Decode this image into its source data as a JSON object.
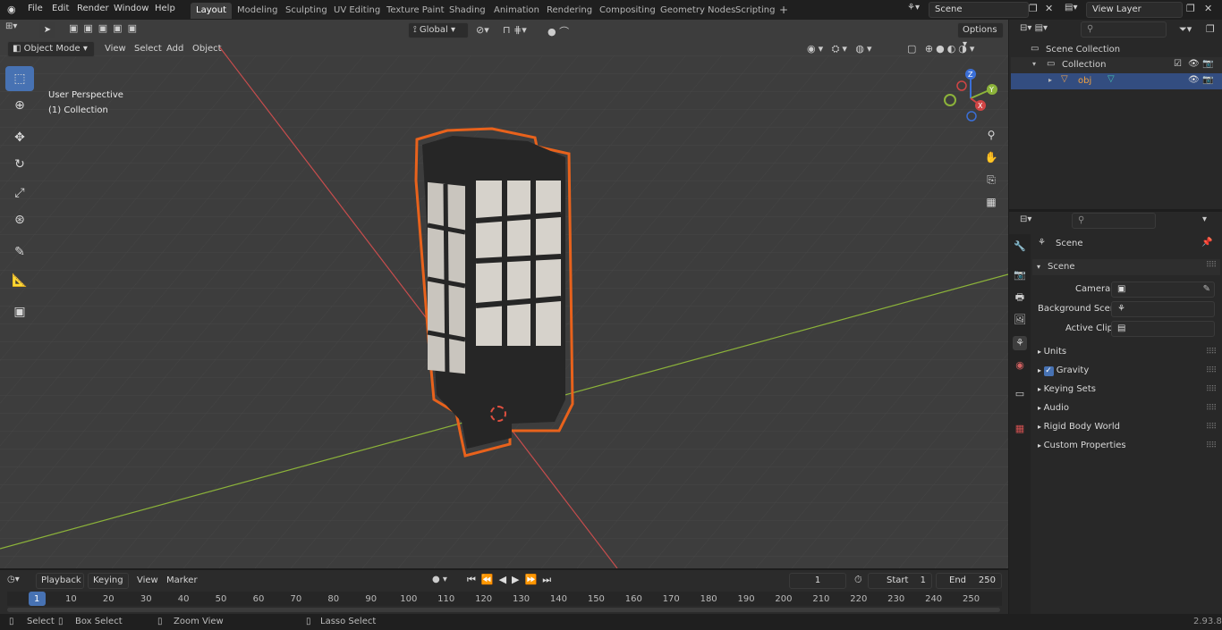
{
  "app": {
    "version": "2.93.8"
  },
  "menu": [
    "File",
    "Edit",
    "Render",
    "Window",
    "Help"
  ],
  "workspaces": [
    "Layout",
    "Modeling",
    "Sculpting",
    "UV Editing",
    "Texture Paint",
    "Shading",
    "Animation",
    "Rendering",
    "Compositing",
    "Geometry Nodes",
    "Scripting"
  ],
  "active_workspace": "Layout",
  "scene_field": "Scene",
  "view_layer_field": "View Layer",
  "viewport_header": {
    "mode": "Object Mode",
    "view": "View",
    "select": "Select",
    "add": "Add",
    "object": "Object",
    "transform_orientation": "Global",
    "options": "Options"
  },
  "overlay": {
    "perspective": "User Perspective",
    "collection": "(1) Collection"
  },
  "gizmo": {
    "z": "Z",
    "y": "Y",
    "x": "X"
  },
  "outliner": {
    "root": "Scene Collection",
    "collection": "Collection",
    "object": "obj"
  },
  "properties": {
    "header": "Scene",
    "panel": "Scene",
    "camera_label": "Camera",
    "background_scene_label": "Background Scene",
    "active_clip_label": "Active Clip",
    "sections": [
      "Units",
      "Gravity",
      "Keying Sets",
      "Audio",
      "Rigid Body World",
      "Custom Properties"
    ]
  },
  "timeline": {
    "playback": "Playback",
    "keying": "Keying",
    "view": "View",
    "marker": "Marker",
    "current_frame": "1",
    "start_label": "Start",
    "start": "1",
    "end_label": "End",
    "end": "250",
    "ticks": [
      "1",
      "10",
      "20",
      "30",
      "40",
      "50",
      "60",
      "70",
      "80",
      "90",
      "100",
      "110",
      "120",
      "130",
      "140",
      "150",
      "160",
      "170",
      "180",
      "190",
      "200",
      "210",
      "220",
      "230",
      "240",
      "250"
    ]
  },
  "status": {
    "select": "Select",
    "box_select": "Box Select",
    "zoom_view": "Zoom View",
    "lasso_select": "Lasso Select"
  },
  "colors": {
    "accent": "#4772b3",
    "selection": "#e8621c",
    "grid_y_axis": "#8cb33a",
    "grid_x_axis": "#c74d4d"
  }
}
